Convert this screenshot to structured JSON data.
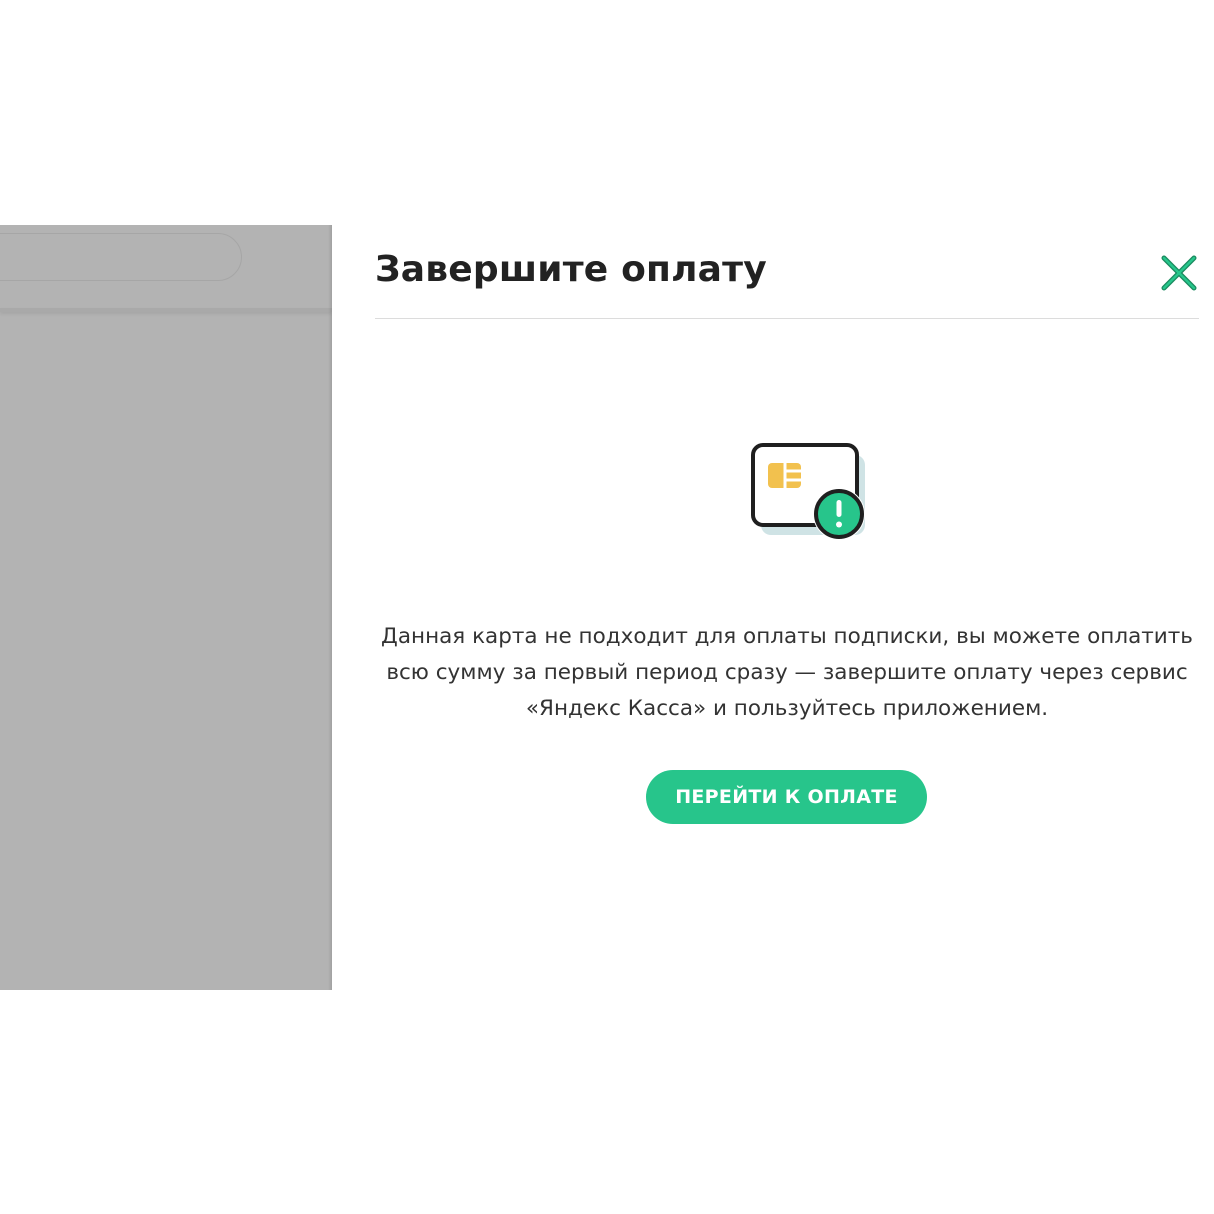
{
  "modal": {
    "title": "Завершите оплату",
    "close_icon": "close-icon",
    "illustration_icon": "card-warning-icon",
    "message": "Данная карта не подходит для оплаты подписки, вы можете оплатить всю сумму за первый период сразу — завершите оплату через сервис «Яндекс Касса» и пользуйтесь приложением.",
    "pay_button_label": "ПЕРЕЙТИ К ОПЛАТЕ"
  },
  "colors": {
    "accent": "#27c58b",
    "backdrop": "#b3b3b3",
    "chip": "#f2c14e",
    "card_shadow": "#cfe3e5",
    "title": "#222222",
    "text": "#333333"
  }
}
